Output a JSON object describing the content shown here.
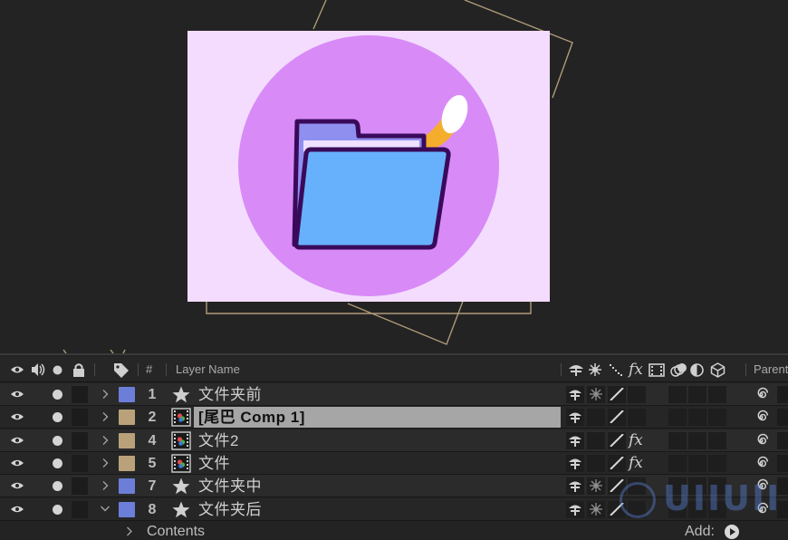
{
  "timeline": {
    "header": {
      "number": "#",
      "layer_name": "Layer Name",
      "fx": "fx",
      "parent": "Parent"
    },
    "layers": [
      {
        "number": "1",
        "name": "文件夹前",
        "type": "shape",
        "label_color": "#6b7fd8",
        "fx": "",
        "selected": false
      },
      {
        "number": "2",
        "name": "[尾巴 Comp 1]",
        "type": "comp",
        "label_color": "#b9a27a",
        "fx": "",
        "selected": true
      },
      {
        "number": "4",
        "name": "文件2",
        "type": "comp",
        "label_color": "#b9a27a",
        "fx": "fx",
        "selected": false
      },
      {
        "number": "5",
        "name": "文件",
        "type": "comp",
        "label_color": "#b9a27a",
        "fx": "fx",
        "selected": false
      },
      {
        "number": "7",
        "name": "文件夹中",
        "type": "shape",
        "label_color": "#6b7fd8",
        "fx": "",
        "selected": false
      },
      {
        "number": "8",
        "name": "文件夹后",
        "type": "shape",
        "label_color": "#6b7fd8",
        "fx": "",
        "selected": false
      }
    ],
    "contents_label": "Contents",
    "add_label": "Add:"
  },
  "watermark": {
    "text": "UIIUII"
  },
  "colors": {
    "artboard_bg": "#f3dcfd",
    "circle": "#d88af7",
    "folder_back": "#8f8ff0",
    "folder_front": "#67b1fc",
    "folder_outline": "#3a0a5a",
    "tail": "#f5ad2e",
    "guide": "#b09a78"
  }
}
